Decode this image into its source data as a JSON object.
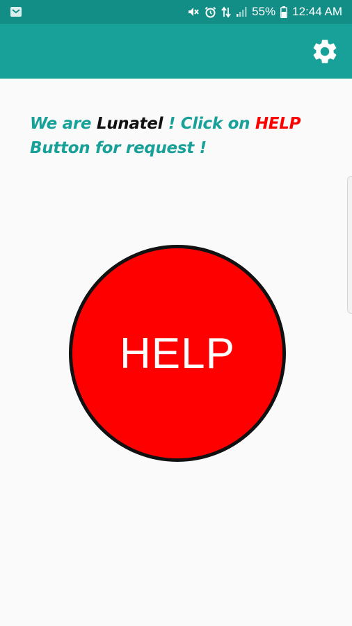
{
  "status_bar": {
    "battery": "55%",
    "time": "12:44 AM",
    "icons": [
      "notification-icon",
      "mute-icon",
      "alarm-icon",
      "data-transfer-icon",
      "signal-icon",
      "battery-icon"
    ]
  },
  "app_bar": {
    "settings_icon": "gear-icon",
    "background_color": "#18a199",
    "status_color": "#138e87"
  },
  "intro": {
    "part1": "We are ",
    "brand": "Lunatel",
    "part2": " ! Click on ",
    "help_word": "HELP",
    "part3": " Button for request !",
    "colors": {
      "text": "#18a199",
      "brand": "#111111",
      "help_word": "#ff0000"
    }
  },
  "help_button": {
    "label": "HELP",
    "fill_color": "#ff0000",
    "border_color": "#111111",
    "text_color": "#ffffff"
  }
}
